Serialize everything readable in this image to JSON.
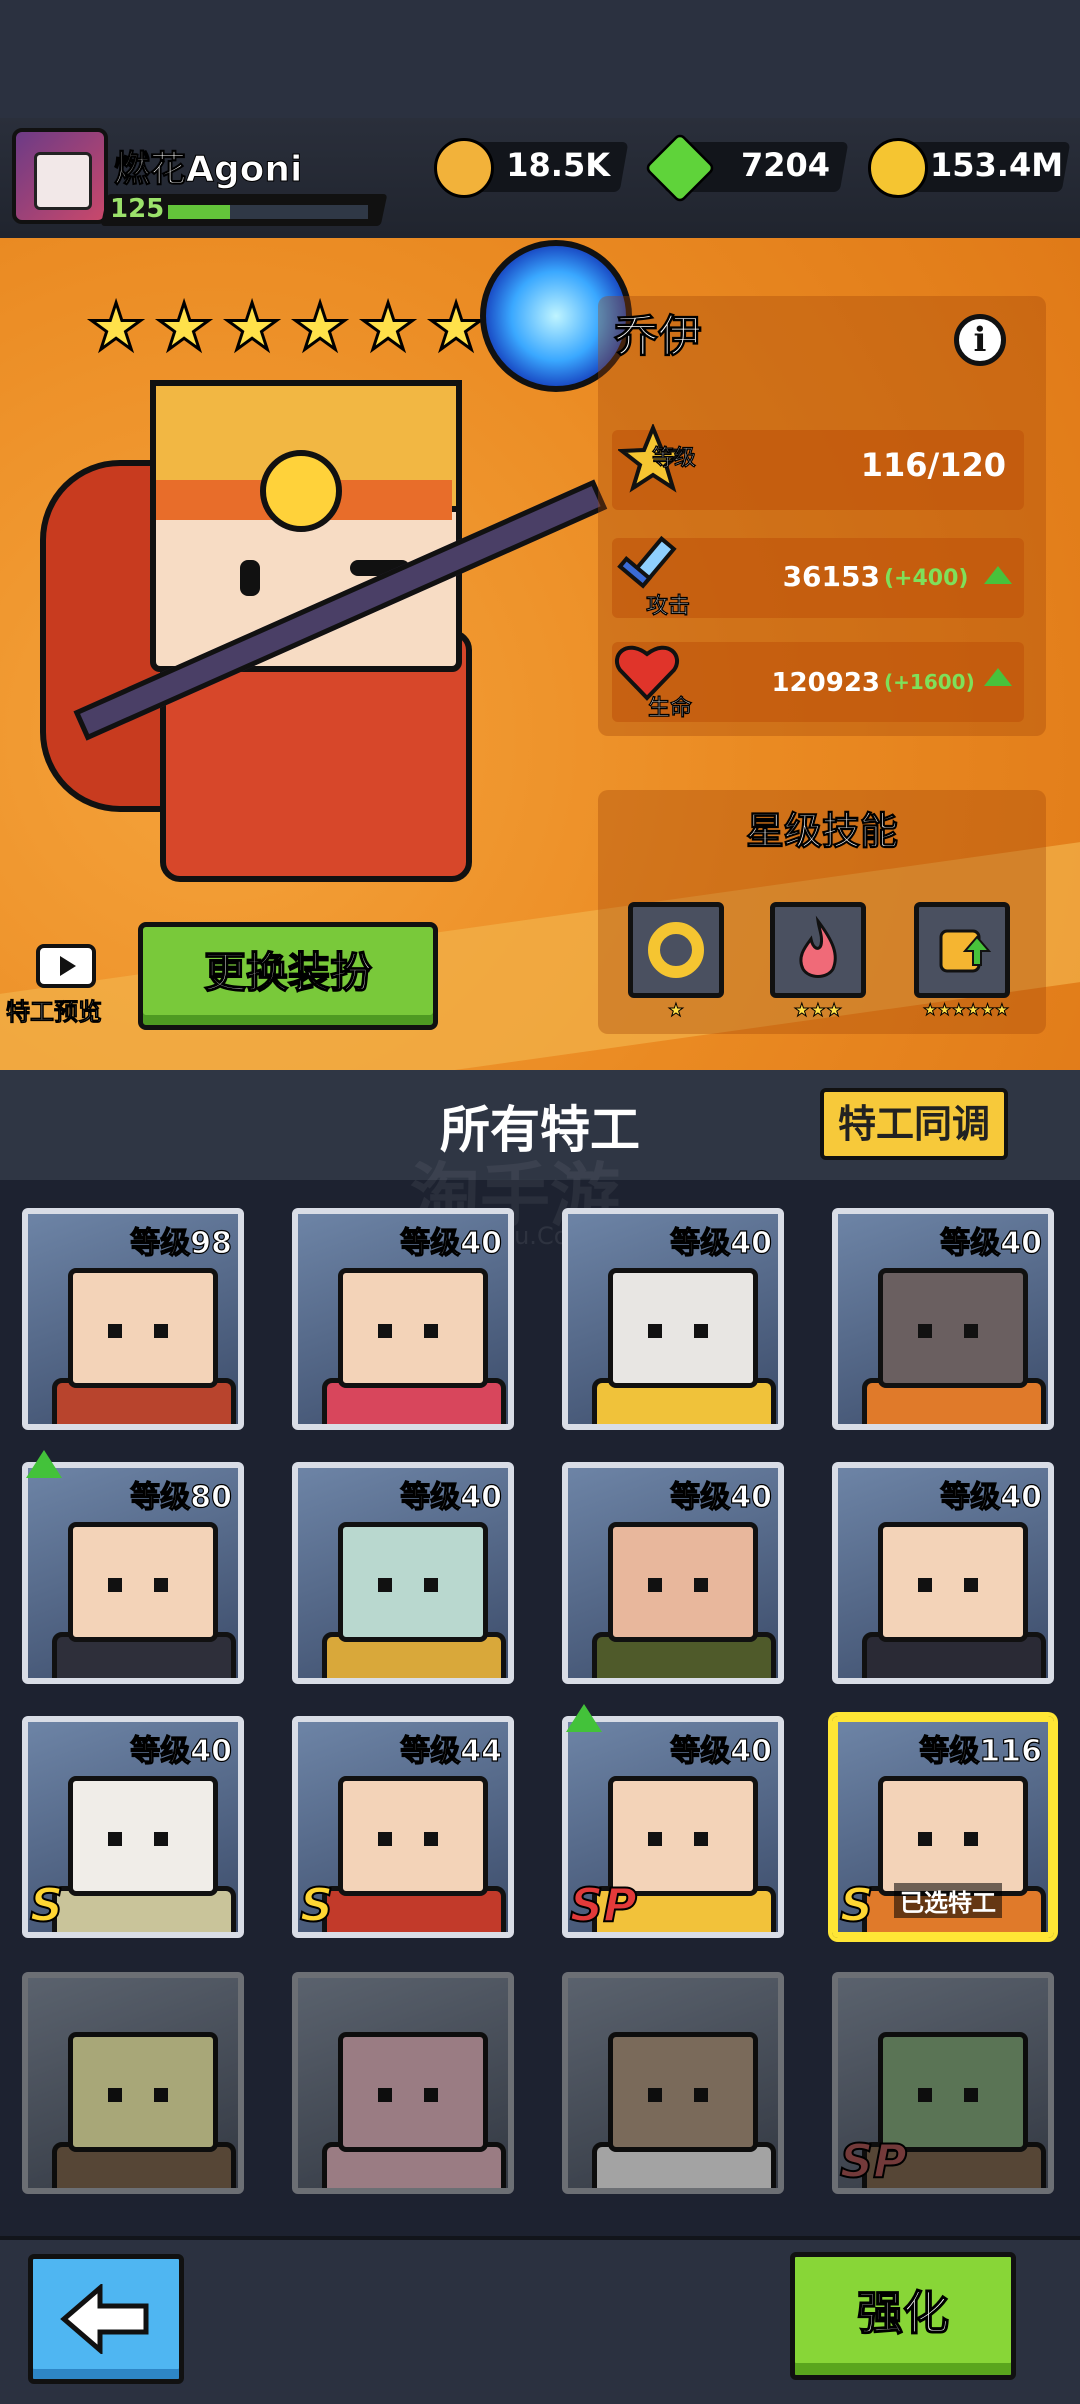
{
  "player": {
    "name": "燃花Agoni",
    "level": "125",
    "xp_fraction": 0.31
  },
  "currencies": [
    {
      "name": "drop",
      "value": "18.5K",
      "color": "#f2b23a",
      "icon": "drop-icon"
    },
    {
      "name": "gem",
      "value": "7204",
      "color": "#5fd33a",
      "icon": "green-gem-icon"
    },
    {
      "name": "coin",
      "value": "153.4M",
      "color": "#f5c531",
      "icon": "gold-coin-icon"
    }
  ],
  "hero": {
    "name": "乔伊",
    "stars": 6,
    "level_label": "等级",
    "level_value": "116/120",
    "attack_label": "攻击",
    "attack_value": "36153",
    "attack_bonus": "(+400)",
    "hp_label": "生命",
    "hp_value": "120923",
    "hp_bonus": "(+1600)"
  },
  "star_skills": {
    "title": "星级技能",
    "skills": [
      {
        "icon": "ring-icon",
        "stars": "★"
      },
      {
        "icon": "flame-icon",
        "stars": "★★★"
      },
      {
        "icon": "fist-up-icon",
        "stars": "★★★★★★"
      }
    ]
  },
  "buttons": {
    "preview": "特工预览",
    "outfit": "更换装扮",
    "sync": "特工同调",
    "upgrade": "强化"
  },
  "roster": {
    "title": "所有特工",
    "agents": [
      {
        "level": "等级98",
        "rank": "",
        "locked": false,
        "upgrade": false,
        "selected": false,
        "skin": "#f3d3b8",
        "shirt": "#b8442d"
      },
      {
        "level": "等级40",
        "rank": "",
        "locked": false,
        "upgrade": false,
        "selected": false,
        "skin": "#f3d3b8",
        "shirt": "#d8465c"
      },
      {
        "level": "等级40",
        "rank": "",
        "locked": false,
        "upgrade": false,
        "selected": false,
        "skin": "#e8e6e3",
        "shirt": "#f0c23a"
      },
      {
        "level": "等级40",
        "rank": "",
        "locked": false,
        "upgrade": false,
        "selected": false,
        "skin": "#6a5f60",
        "shirt": "#e07a2a"
      },
      {
        "level": "等级80",
        "rank": "",
        "locked": false,
        "upgrade": true,
        "selected": false,
        "skin": "#f3d3b8",
        "shirt": "#2e2f3a"
      },
      {
        "level": "等级40",
        "rank": "",
        "locked": false,
        "upgrade": false,
        "selected": false,
        "skin": "#b9d8cf",
        "shirt": "#d9a83a"
      },
      {
        "level": "等级40",
        "rank": "",
        "locked": false,
        "upgrade": false,
        "selected": false,
        "skin": "#e8b79c",
        "shirt": "#4f5a2a"
      },
      {
        "level": "等级40",
        "rank": "",
        "locked": false,
        "upgrade": false,
        "selected": false,
        "skin": "#f3d3b8",
        "shirt": "#2a2a35"
      },
      {
        "level": "等级40",
        "rank": "S",
        "locked": false,
        "upgrade": false,
        "selected": false,
        "skin": "#f0ede8",
        "shirt": "#c9c49a"
      },
      {
        "level": "等级44",
        "rank": "S",
        "locked": false,
        "upgrade": false,
        "selected": false,
        "skin": "#f3d3b8",
        "shirt": "#c23a2a"
      },
      {
        "level": "等级40",
        "rank": "SP",
        "locked": false,
        "upgrade": true,
        "selected": false,
        "skin": "#f3d3b8",
        "shirt": "#f2c23a"
      },
      {
        "level": "等级116",
        "rank": "S",
        "locked": false,
        "upgrade": false,
        "selected": true,
        "tag": "已选特工",
        "skin": "#f3d3b8",
        "shirt": "#e07a2a"
      },
      {
        "level": "",
        "rank": "",
        "locked": true,
        "upgrade": false,
        "selected": false,
        "skin": "#e7e35a",
        "shirt": "#8a5a2a"
      },
      {
        "level": "",
        "rank": "",
        "locked": true,
        "upgrade": false,
        "selected": false,
        "skin": "#f39ab0",
        "shirt": "#f39ab0"
      },
      {
        "level": "",
        "rank": "",
        "locked": true,
        "upgrade": false,
        "selected": false,
        "skin": "#b98a5a",
        "shirt": "#d9d9d9"
      },
      {
        "level": "",
        "rank": "SP",
        "locked": true,
        "upgrade": false,
        "selected": false,
        "skin": "#5aa84a",
        "shirt": "#8a5a2a"
      }
    ]
  },
  "watermark": {
    "main": "淘手游",
    "sub": "uyou.Com"
  }
}
